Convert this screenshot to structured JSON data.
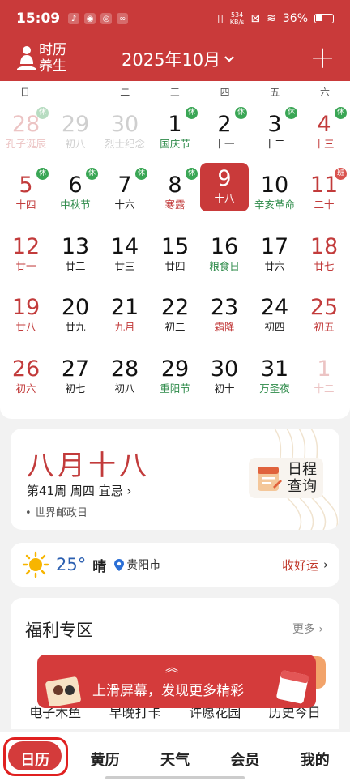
{
  "status_bar": {
    "time": "15:09",
    "net_speed_value": "534",
    "net_speed_unit": "KB/s",
    "battery": "36%"
  },
  "header": {
    "logo_line1": "时历",
    "logo_line2": "养生",
    "month_title": "2025年10月",
    "add_label": "+"
  },
  "calendar": {
    "weekdays": [
      "日",
      "一",
      "二",
      "三",
      "四",
      "五",
      "六"
    ],
    "days": [
      {
        "num": "28",
        "lunar": "孔子诞辰",
        "faded": true,
        "badge": "休"
      },
      {
        "num": "29",
        "lunar": "初八",
        "faded": true
      },
      {
        "num": "30",
        "lunar": "烈士纪念",
        "faded": true
      },
      {
        "num": "1",
        "lunar": "国庆节",
        "lunar_color": "green",
        "badge": "休"
      },
      {
        "num": "2",
        "lunar": "十一",
        "badge": "休"
      },
      {
        "num": "3",
        "lunar": "十二",
        "badge": "休"
      },
      {
        "num": "4",
        "lunar": "十三",
        "badge": "休"
      },
      {
        "num": "5",
        "lunar": "十四",
        "badge": "休"
      },
      {
        "num": "6",
        "lunar": "中秋节",
        "lunar_color": "green",
        "badge": "休"
      },
      {
        "num": "7",
        "lunar": "十六",
        "badge": "休"
      },
      {
        "num": "8",
        "lunar": "寒露",
        "lunar_color": "red",
        "badge": "休"
      },
      {
        "num": "9",
        "lunar": "十八",
        "today": true
      },
      {
        "num": "10",
        "lunar": "辛亥革命",
        "lunar_color": "green"
      },
      {
        "num": "11",
        "lunar": "二十",
        "badge": "班",
        "num_color": "red"
      },
      {
        "num": "12",
        "lunar": "廿一"
      },
      {
        "num": "13",
        "lunar": "廿二"
      },
      {
        "num": "14",
        "lunar": "廿三"
      },
      {
        "num": "15",
        "lunar": "廿四"
      },
      {
        "num": "16",
        "lunar": "粮食日",
        "lunar_color": "green"
      },
      {
        "num": "17",
        "lunar": "廿六"
      },
      {
        "num": "18",
        "lunar": "廿七"
      },
      {
        "num": "19",
        "lunar": "廿八"
      },
      {
        "num": "20",
        "lunar": "廿九"
      },
      {
        "num": "21",
        "lunar": "九月",
        "lunar_color": "red"
      },
      {
        "num": "22",
        "lunar": "初二"
      },
      {
        "num": "23",
        "lunar": "霜降",
        "lunar_color": "red"
      },
      {
        "num": "24",
        "lunar": "初四"
      },
      {
        "num": "25",
        "lunar": "初五"
      },
      {
        "num": "26",
        "lunar": "初六"
      },
      {
        "num": "27",
        "lunar": "初七"
      },
      {
        "num": "28",
        "lunar": "初八"
      },
      {
        "num": "29",
        "lunar": "重阳节",
        "lunar_color": "green"
      },
      {
        "num": "30",
        "lunar": "初十"
      },
      {
        "num": "31",
        "lunar": "万圣夜",
        "lunar_color": "green"
      },
      {
        "num": "1",
        "lunar": "十二",
        "faded": true
      }
    ]
  },
  "date_card": {
    "lunar_date": "八月十八",
    "week_info": "第41周 周四 宜忌",
    "holiday": "世界邮政日",
    "schedule_line1": "日程",
    "schedule_line2": "查询"
  },
  "weather": {
    "temperature": "25°",
    "condition": "晴",
    "city": "贵阳市",
    "luck_label": "收好运"
  },
  "welfare": {
    "title": "福利专区",
    "more": "更多",
    "items": [
      "电子木鱼",
      "早晚打卡",
      "许愿花园",
      "历史今日"
    ],
    "banner": "上滑屏幕，发现更多精彩"
  },
  "bottom_nav": {
    "items": [
      "日历",
      "黄历",
      "天气",
      "会员",
      "我的"
    ]
  },
  "colors": {
    "brand_red": "#c93a3a",
    "rest_green": "#3aa655",
    "holiday_green": "#2e8b4a"
  }
}
